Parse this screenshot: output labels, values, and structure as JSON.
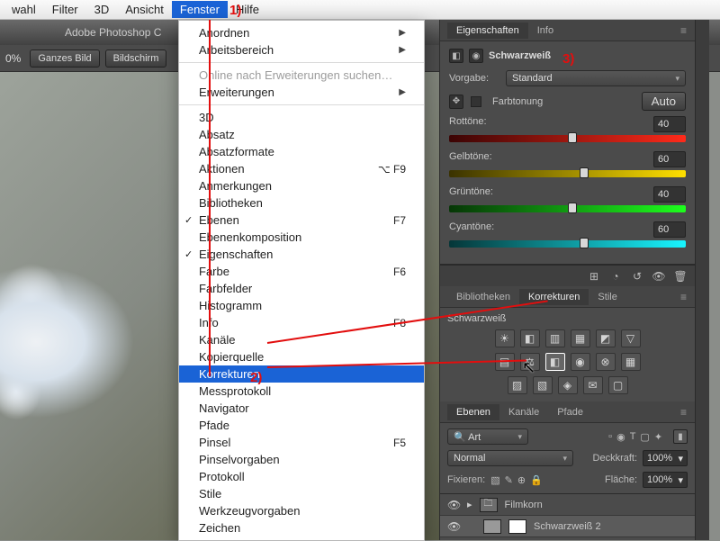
{
  "menubar": {
    "items": [
      "wahl",
      "Filter",
      "3D",
      "Ansicht",
      "Fenster",
      "Hilfe"
    ],
    "active_index": 4
  },
  "app": {
    "title": "Adobe Photoshop C",
    "zoom": "0%",
    "buttons": [
      "Ganzes Bild",
      "Bildschirm"
    ]
  },
  "dropdown": {
    "groups": [
      [
        {
          "label": "Anordnen",
          "sub": true
        },
        {
          "label": "Arbeitsbereich",
          "sub": true
        }
      ],
      [
        {
          "label": "Online nach Erweiterungen suchen…",
          "dim": true
        },
        {
          "label": "Erweiterungen",
          "sub": true
        }
      ],
      [
        {
          "label": "3D"
        },
        {
          "label": "Absatz"
        },
        {
          "label": "Absatzformate"
        },
        {
          "label": "Aktionen",
          "shortcut": "⌥ F9"
        },
        {
          "label": "Anmerkungen"
        },
        {
          "label": "Bibliotheken"
        },
        {
          "label": "Ebenen",
          "check": true,
          "shortcut": "F7"
        },
        {
          "label": "Ebenenkomposition"
        },
        {
          "label": "Eigenschaften",
          "check": true
        },
        {
          "label": "Farbe",
          "shortcut": "F6"
        },
        {
          "label": "Farbfelder"
        },
        {
          "label": "Histogramm"
        },
        {
          "label": "Info",
          "shortcut": "F8"
        },
        {
          "label": "Kanäle"
        },
        {
          "label": "Kopierquelle"
        },
        {
          "label": "Korrekturen",
          "hl": true
        },
        {
          "label": "Messprotokoll"
        },
        {
          "label": "Navigator"
        },
        {
          "label": "Pfade"
        },
        {
          "label": "Pinsel",
          "shortcut": "F5"
        },
        {
          "label": "Pinselvorgaben"
        },
        {
          "label": "Protokoll"
        },
        {
          "label": "Stile"
        },
        {
          "label": "Werkzeugvorgaben"
        },
        {
          "label": "Zeichen"
        }
      ]
    ]
  },
  "properties": {
    "tabs": [
      "Eigenschaften",
      "Info"
    ],
    "active_tab": 0,
    "adjustment_name": "Schwarzweiß",
    "preset_label": "Vorgabe:",
    "preset_value": "Standard",
    "toning_label": "Farbtonung",
    "auto_label": "Auto",
    "sliders": [
      {
        "name": "Rottöne:",
        "value": 40,
        "pct": 50,
        "cls": "grad-red"
      },
      {
        "name": "Gelbtöne:",
        "value": 60,
        "pct": 55,
        "cls": "grad-yel"
      },
      {
        "name": "Grüntöne:",
        "value": 40,
        "pct": 50,
        "cls": "grad-grn"
      },
      {
        "name": "Cyantöne:",
        "value": 60,
        "pct": 55,
        "cls": "grad-cyn"
      }
    ],
    "botbar_icons": [
      "⊞",
      "◔",
      "↺",
      "👁",
      "🗑"
    ]
  },
  "libraries": {
    "tabs": [
      "Bibliotheken",
      "Korrekturen",
      "Stile"
    ],
    "active_tab": 1,
    "heading": "Schwarzweiß",
    "icons_row1": [
      "☀",
      "◧",
      "▥",
      "▦",
      "◩",
      "▽"
    ],
    "icons_row2": [
      "▤",
      "⚖",
      "◧",
      "◉",
      "⊗",
      "▦"
    ],
    "icons_row3": [
      "▨",
      "▧",
      "◈",
      "✉",
      "▢"
    ],
    "selected_index": [
      1,
      2
    ]
  },
  "layers": {
    "tabs": [
      "Ebenen",
      "Kanäle",
      "Pfade"
    ],
    "active_tab": 0,
    "filter_label": "Art",
    "filter_icons": [
      "▫",
      "◉",
      "T",
      "▢",
      "✦"
    ],
    "blend_value": "Normal",
    "opacity_label": "Deckkraft:",
    "opacity_value": "100%",
    "lock_label": "Fixieren:",
    "lock_icons": [
      "▧",
      "✎",
      "⊕",
      "🔒"
    ],
    "fill_label": "Fläche:",
    "fill_value": "100%",
    "rows": [
      {
        "eye": "👁",
        "kind": "group",
        "name": "Filmkorn",
        "expand": "▸",
        "sel": false
      },
      {
        "eye": "👁",
        "kind": "adj",
        "name": "Schwarzweiß 2",
        "sel": true
      }
    ]
  },
  "annotations": {
    "a1": "1)",
    "a2": "2)",
    "a3": "3)"
  }
}
